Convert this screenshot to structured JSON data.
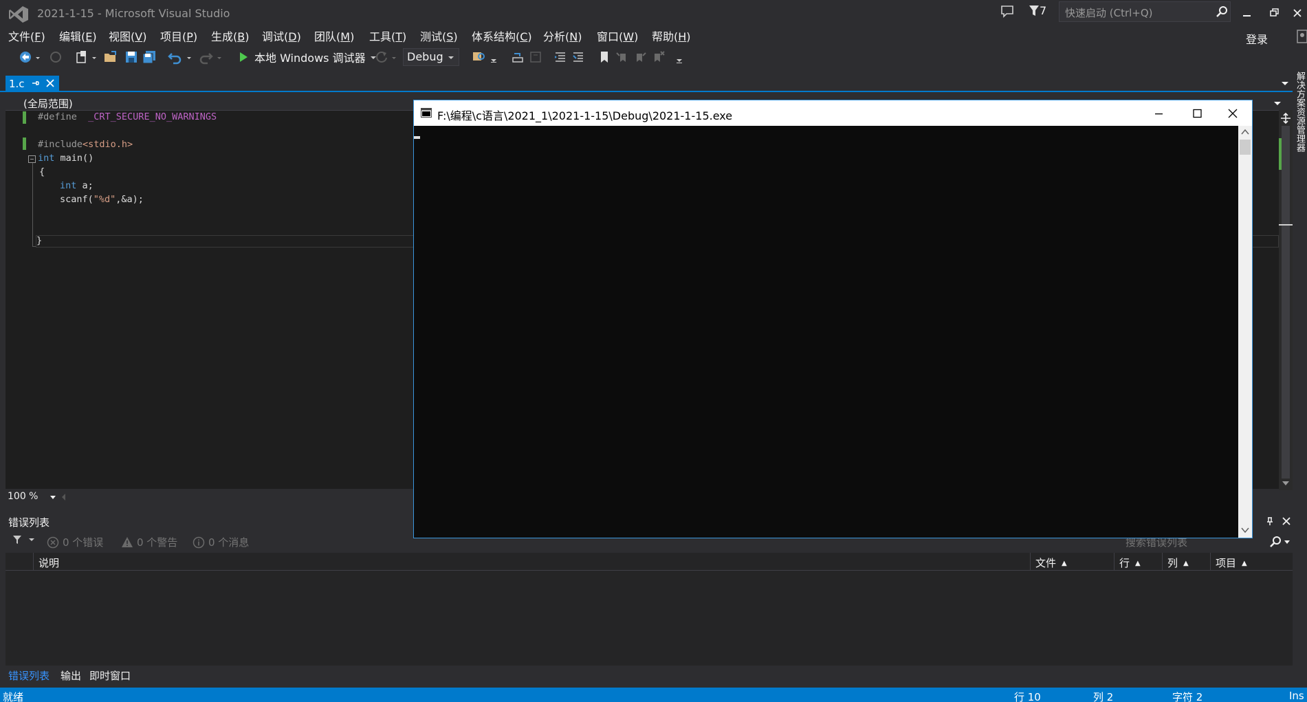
{
  "window": {
    "title": "2021-1-15 - Microsoft Visual Studio",
    "notification_count": "7",
    "quick_launch_placeholder": "快速启动 (Ctrl+Q)",
    "login_label": "登录"
  },
  "menu": [
    {
      "label": "文件(",
      "key": "F",
      "end": ")"
    },
    {
      "label": "编辑(",
      "key": "E",
      "end": ")"
    },
    {
      "label": "视图(",
      "key": "V",
      "end": ")"
    },
    {
      "label": "项目(",
      "key": "P",
      "end": ")"
    },
    {
      "label": "生成(",
      "key": "B",
      "end": ")"
    },
    {
      "label": "调试(",
      "key": "D",
      "end": ")"
    },
    {
      "label": "团队(",
      "key": "M",
      "end": ")"
    },
    {
      "label": "工具(",
      "key": "T",
      "end": ")"
    },
    {
      "label": "测试(",
      "key": "S",
      "end": ")"
    },
    {
      "label": "体系结构(",
      "key": "C",
      "end": ")"
    },
    {
      "label": "分析(",
      "key": "N",
      "end": ")"
    },
    {
      "label": "窗口(",
      "key": "W",
      "end": ")"
    },
    {
      "label": "帮助(",
      "key": "H",
      "end": ")"
    }
  ],
  "toolbar": {
    "run_label": "本地 Windows 调试器",
    "configuration": "Debug"
  },
  "tab": {
    "label": "1.c"
  },
  "editor": {
    "scope": "(全局范围)",
    "zoom": "100 %",
    "lines": [
      {
        "pre": "#define",
        "macro": "  _CRT_SECURE_NO_WARNINGS"
      },
      {
        "pre": "#include",
        "str": "<stdio.h>"
      },
      {
        "kw": "int",
        "rest": " main()"
      },
      {
        "text": "{"
      },
      {
        "kw": "int",
        "rest": " a;"
      },
      {
        "fn": "scanf(",
        "str": "\"%d\"",
        "rest": ",&a);"
      },
      {
        "text": "}"
      }
    ]
  },
  "error_list": {
    "title": "错误列表",
    "errors": "0 个错误",
    "warnings": "0 个警告",
    "messages": "0 个消息",
    "search_placeholder": "搜索错误列表",
    "columns": {
      "description": "说明",
      "file": "文件",
      "line": "行",
      "column": "列",
      "project": "项目"
    }
  },
  "bottom_tabs": [
    "错误列表",
    "输出",
    "即时窗口"
  ],
  "side_tab": "解决方案资源管理器",
  "status": {
    "ready": "就绪",
    "line": "行 10",
    "column": "列 2",
    "char": "字符 2",
    "mode": "Ins"
  },
  "console": {
    "title": "F:\\编程\\c语言\\2021_1\\2021-1-15\\Debug\\2021-1-15.exe"
  },
  "colors": {
    "accent": "#007acc",
    "editor_bg": "#1e1e1e",
    "chrome_bg": "#2d2d30",
    "console_bg": "#0c0c0c",
    "change_bar": "#57a64a"
  }
}
